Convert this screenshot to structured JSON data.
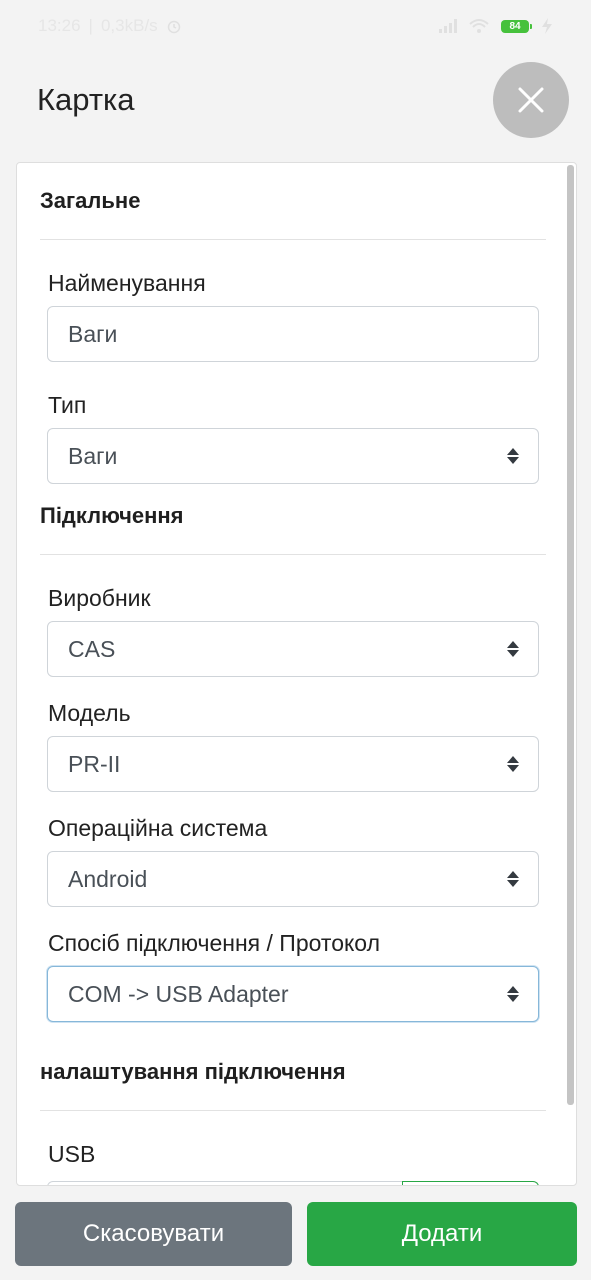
{
  "status_bar": {
    "time": "13:26",
    "speed": "0,3kB/s",
    "battery": "84"
  },
  "header": {
    "title": "Картка",
    "close_icon": "close-icon"
  },
  "sections": {
    "general": "Загальне",
    "connection": "Підключення",
    "connection_settings": "налаштування підключення"
  },
  "fields": {
    "name": {
      "label": "Найменування",
      "value": "Ваги"
    },
    "type": {
      "label": "Тип",
      "value": "Ваги"
    },
    "manufacturer": {
      "label": "Виробник",
      "value": "CAS"
    },
    "model": {
      "label": "Модель",
      "value": "PR-II"
    },
    "os": {
      "label": "Операційна система",
      "value": "Android"
    },
    "protocol": {
      "label": "Спосіб підключення / Протокол",
      "value": "COM -> USB Adapter"
    },
    "usb": {
      "label": "USB"
    }
  },
  "buttons": {
    "cancel": "Скасовувати",
    "add": "Додати"
  },
  "colors": {
    "primary_green": "#28a745",
    "secondary_gray": "#6c757d",
    "close_bg": "#bdbdbd"
  }
}
